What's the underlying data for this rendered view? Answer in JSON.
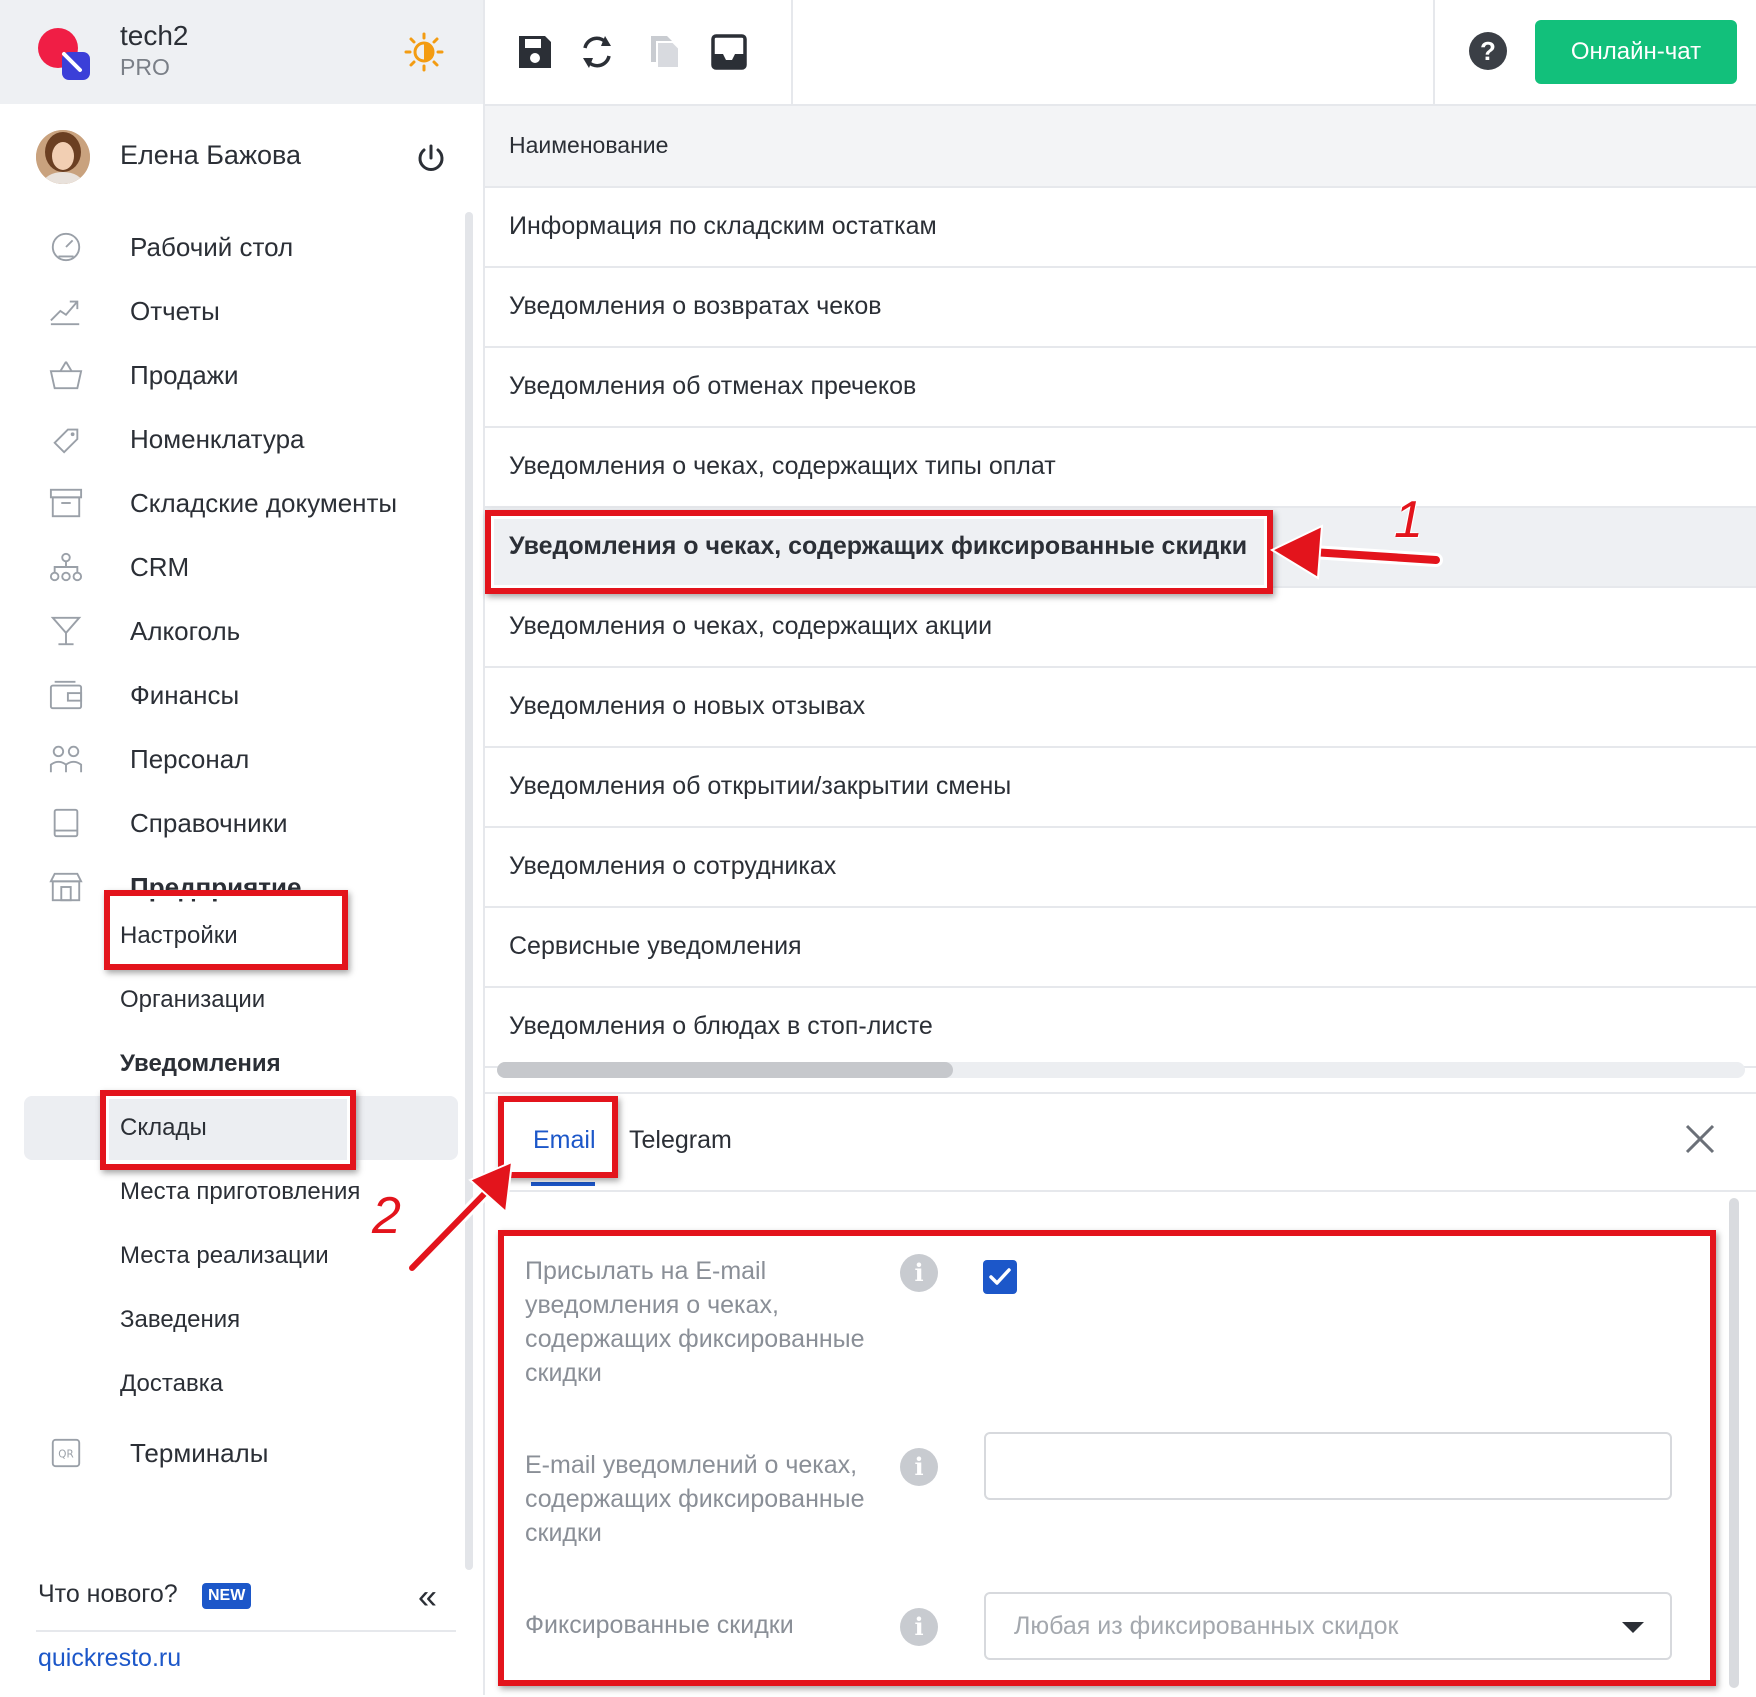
{
  "brand": {
    "name": "tech2",
    "plan": "PRO"
  },
  "user": {
    "name": "Елена Бажова"
  },
  "nav": [
    {
      "label": "Рабочий стол",
      "icon": "dashboard-icon"
    },
    {
      "label": "Отчеты",
      "icon": "reports-icon"
    },
    {
      "label": "Продажи",
      "icon": "basket-icon"
    },
    {
      "label": "Номенклатура",
      "icon": "tag-icon"
    },
    {
      "label": "Складские документы",
      "icon": "archive-icon"
    },
    {
      "label": "CRM",
      "icon": "crm-icon"
    },
    {
      "label": "Алкоголь",
      "icon": "cocktail-icon"
    },
    {
      "label": "Финансы",
      "icon": "wallet-icon"
    },
    {
      "label": "Персонал",
      "icon": "people-icon"
    },
    {
      "label": "Справочники",
      "icon": "book-icon"
    },
    {
      "label": "Предприятие",
      "icon": "store-icon"
    }
  ],
  "subnav": [
    {
      "label": "Настройки"
    },
    {
      "label": "Организации"
    },
    {
      "label": "Уведомления"
    },
    {
      "label": "Склады"
    },
    {
      "label": "Места приготовления"
    },
    {
      "label": "Места реализации"
    },
    {
      "label": "Заведения"
    },
    {
      "label": "Доставка"
    }
  ],
  "nav_after": {
    "label": "Терминалы",
    "icon": "qr-icon"
  },
  "whats_new": "Что нового?",
  "new_badge": "NEW",
  "collapse_label": "«",
  "site_link": "quickresto.ru",
  "toolbar": {
    "chat_label": "Онлайн-чат",
    "help_label": "?"
  },
  "table": {
    "header": "Наименование",
    "rows": [
      "Информация по складским остаткам",
      "Уведомления о возвратах чеков",
      "Уведомления об отменах пречеков",
      "Уведомления о чеках, содержащих типы оплат",
      "Уведомления о чеках, содержащих фиксированные скидки",
      "Уведомления о чеках, содержащих акции",
      "Уведомления о новых отзывах",
      "Уведомления об открытии/закрытии смены",
      "Уведомления о сотрудниках",
      "Сервисные уведомления",
      "Уведомления о блюдах в стоп-листе"
    ],
    "selected_index": 4
  },
  "panel": {
    "tabs": [
      "Email",
      "Telegram"
    ],
    "active_tab": "Email",
    "fields": {
      "send_label": "Присылать на E-mail уведомления о чеках, содержащих фиксированные скидки",
      "send_checked": true,
      "email_label": "E-mail уведомлений о чеках, содержащих фиксированные скидки",
      "email_value": "",
      "discount_label": "Фиксированные скидки",
      "discount_value": "Любая из фиксированных скидок"
    }
  },
  "annotations": {
    "num1": "1",
    "num2": "2"
  },
  "colors": {
    "accent": "#1c57c9",
    "chat": "#12c07b",
    "annotation": "#e3141c"
  }
}
